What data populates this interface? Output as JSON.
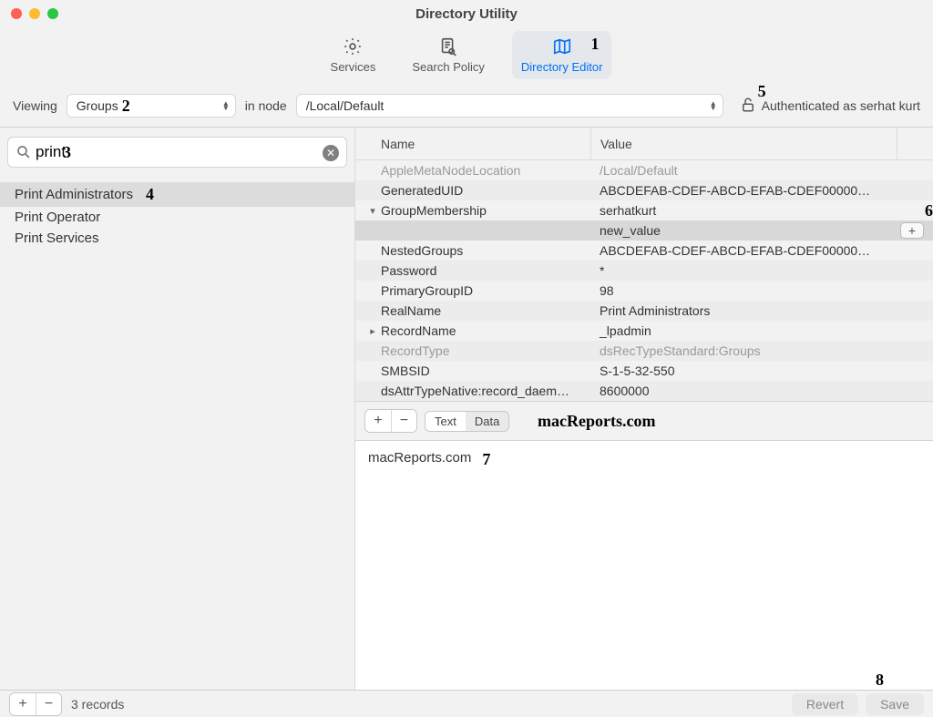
{
  "window": {
    "title": "Directory Utility"
  },
  "tabs": {
    "services": "Services",
    "search_policy": "Search Policy",
    "directory_editor": "Directory Editor"
  },
  "filter": {
    "viewing_label": "Viewing",
    "viewing_value": "Groups",
    "in_node_label": "in node",
    "node_value": "/Local/Default",
    "auth_text": "Authenticated as serhat kurt"
  },
  "search": {
    "value": "print"
  },
  "results": [
    {
      "label": "Print Administrators",
      "selected": true
    },
    {
      "label": "Print Operator",
      "selected": false
    },
    {
      "label": "Print Services",
      "selected": false
    }
  ],
  "table": {
    "col_name": "Name",
    "col_value": "Value",
    "rows": [
      {
        "name": "AppleMetaNodeLocation",
        "value": "/Local/Default",
        "dim": true,
        "alt": false,
        "chev": ""
      },
      {
        "name": "GeneratedUID",
        "value": "ABCDEFAB-CDEF-ABCD-EFAB-CDEF00000…",
        "dim": false,
        "alt": true,
        "chev": ""
      },
      {
        "name": "GroupMembership",
        "value": "serhatkurt",
        "dim": false,
        "alt": false,
        "chev": "▾",
        "annot": "6"
      },
      {
        "name": "",
        "value": "new_value",
        "dim": false,
        "alt": false,
        "chev": "",
        "sel": true,
        "plus": true
      },
      {
        "name": "NestedGroups",
        "value": "ABCDEFAB-CDEF-ABCD-EFAB-CDEF00000…",
        "dim": false,
        "alt": false,
        "chev": ""
      },
      {
        "name": "Password",
        "value": "*",
        "dim": false,
        "alt": true,
        "chev": ""
      },
      {
        "name": "PrimaryGroupID",
        "value": "98",
        "dim": false,
        "alt": false,
        "chev": ""
      },
      {
        "name": "RealName",
        "value": "Print Administrators",
        "dim": false,
        "alt": true,
        "chev": ""
      },
      {
        "name": "RecordName",
        "value": "_lpadmin",
        "dim": false,
        "alt": false,
        "chev": "▸"
      },
      {
        "name": "RecordType",
        "value": "dsRecTypeStandard:Groups",
        "dim": true,
        "alt": true,
        "chev": ""
      },
      {
        "name": "SMBSID",
        "value": "S-1-5-32-550",
        "dim": false,
        "alt": false,
        "chev": ""
      },
      {
        "name": "dsAttrTypeNative:record_daem…",
        "value": "8600000",
        "dim": false,
        "alt": true,
        "chev": ""
      }
    ]
  },
  "seg": {
    "text": "Text",
    "data": "Data"
  },
  "brand": "macReports.com",
  "detail": {
    "text": "macReports.com",
    "annot": "7"
  },
  "footer": {
    "records": "3 records",
    "revert": "Revert",
    "save": "Save"
  },
  "annots": {
    "tab": "1",
    "viewing": "2",
    "search": "3",
    "result": "4",
    "lock": "5",
    "save": "8"
  }
}
